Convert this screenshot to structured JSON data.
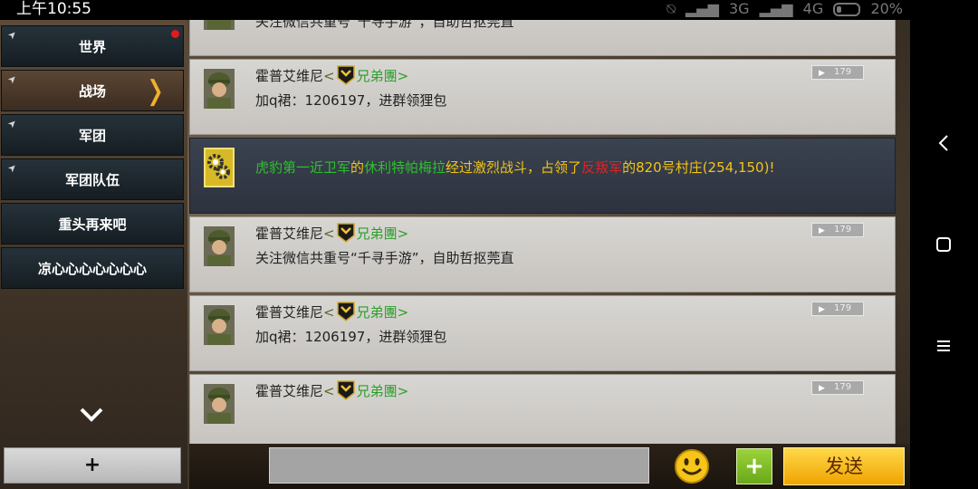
{
  "status": {
    "time": "上午10:55",
    "net1": "3G",
    "net2": "4G",
    "battery": "20%"
  },
  "channels": [
    {
      "label": "世界",
      "pinned": true,
      "unread": true
    },
    {
      "label": "战场",
      "pinned": true,
      "active": true
    },
    {
      "label": "军团",
      "pinned": true
    },
    {
      "label": "军团队伍",
      "pinned": true
    },
    {
      "label": "重头再来吧"
    },
    {
      "label": "凉心心心心心心心"
    }
  ],
  "sidebar": {
    "add_label": "+"
  },
  "messages": [
    {
      "user": "霍普艾维尼",
      "guild": "兄弟團",
      "text": "关注微信共重号“千寻手游”，自助哲抠莞直",
      "votes": "179"
    },
    {
      "user": "霍普艾维尼",
      "guild": "兄弟團",
      "text": "加q裙：1206197，进群领狸包",
      "votes": "179"
    },
    {
      "system": true,
      "parts": [
        {
          "t": "虎豹第一近卫军",
          "c": "green"
        },
        {
          "t": "的",
          "c": "yellow"
        },
        {
          "t": "休利特帕梅拉",
          "c": "green"
        },
        {
          "t": "经过激烈战斗，占领了",
          "c": "yellow"
        },
        {
          "t": "反叛军",
          "c": "red"
        },
        {
          "t": "的820号村庄(254,150)!",
          "c": "yellow"
        }
      ]
    },
    {
      "user": "霍普艾维尼",
      "guild": "兄弟團",
      "text": "关注微信共重号“千寻手游”，自助哲抠莞直",
      "votes": "179"
    },
    {
      "user": "霍普艾维尼",
      "guild": "兄弟團",
      "text": "加q裙：1206197，进群领狸包",
      "votes": "179"
    },
    {
      "user": "霍普艾维尼",
      "guild": "兄弟團",
      "text": "",
      "votes": "179"
    }
  ],
  "input": {
    "value": "",
    "placeholder": ""
  },
  "buttons": {
    "plus": "+",
    "send": "发送"
  },
  "colors": {
    "guild": "#29a029",
    "system_green": "#2fbf2f",
    "system_yellow": "#f2c416",
    "system_red": "#e02424",
    "send": "#f0a400"
  }
}
